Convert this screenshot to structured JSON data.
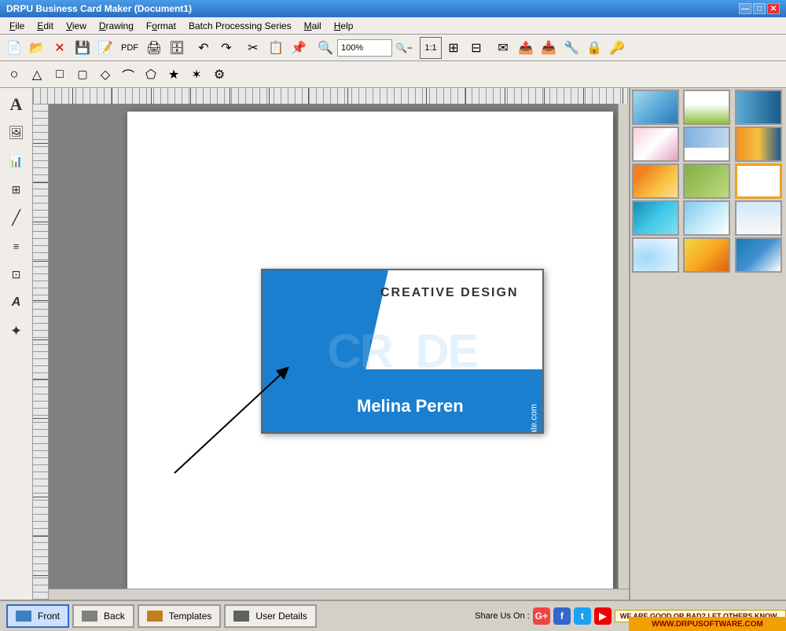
{
  "window": {
    "title": "DRPU Business Card Maker (Document1)",
    "controls": {
      "minimize": "—",
      "maximize": "□",
      "close": "✕"
    }
  },
  "menubar": {
    "items": [
      {
        "id": "file",
        "label": "File",
        "underline": "F"
      },
      {
        "id": "edit",
        "label": "Edit",
        "underline": "E"
      },
      {
        "id": "view",
        "label": "View",
        "underline": "V"
      },
      {
        "id": "drawing",
        "label": "Drawing",
        "underline": "D"
      },
      {
        "id": "format",
        "label": "Format",
        "underline": "o"
      },
      {
        "id": "batch",
        "label": "Batch Processing Series",
        "underline": "B"
      },
      {
        "id": "mail",
        "label": "Mail",
        "underline": "M"
      },
      {
        "id": "help",
        "label": "Help",
        "underline": "H"
      }
    ]
  },
  "toolbar": {
    "zoom_value": "100%",
    "zoom_placeholder": "100%"
  },
  "card": {
    "name": "Melina Peren",
    "email": "peren@create.com",
    "line1": "CREATIVE DESIGN",
    "watermark1": "CR",
    "watermark2": "DE"
  },
  "bottombar": {
    "front_label": "Front",
    "back_label": "Back",
    "templates_label": "Templates",
    "user_details_label": "User Details",
    "share_label": "Share Us On :",
    "feedback_label": "WE ARE GOOD OR BAD? LET OTHERS KNOW.."
  },
  "statusbar": {
    "website": "WWW.DRPUSOFTWARE.COM"
  },
  "templates": {
    "count": 15
  }
}
